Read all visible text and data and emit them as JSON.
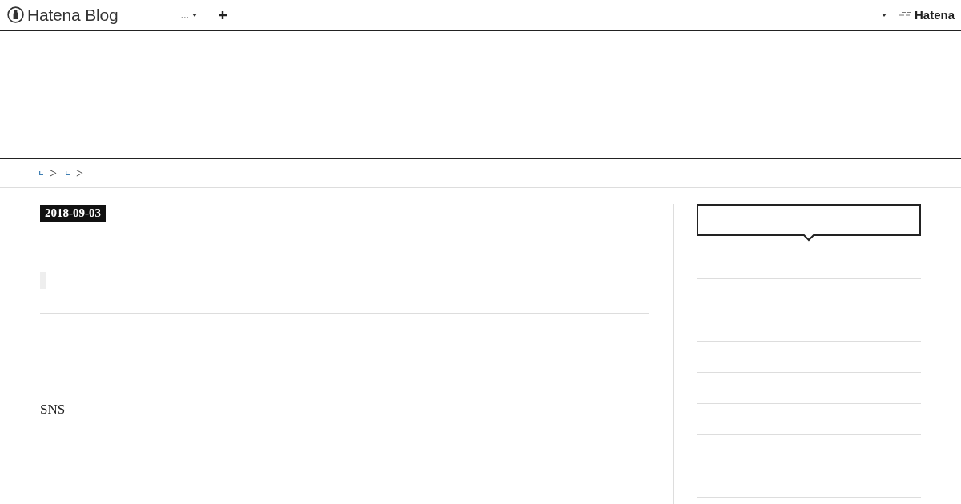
{
  "top_bar": {
    "logo_text": "Hatena Blog",
    "menu_label": "...",
    "brand": "Hatena"
  },
  "breadcrumb": {
    "separators": [
      ">",
      ">"
    ]
  },
  "article": {
    "date": "2018-09-03",
    "paragraph": "SNS"
  }
}
